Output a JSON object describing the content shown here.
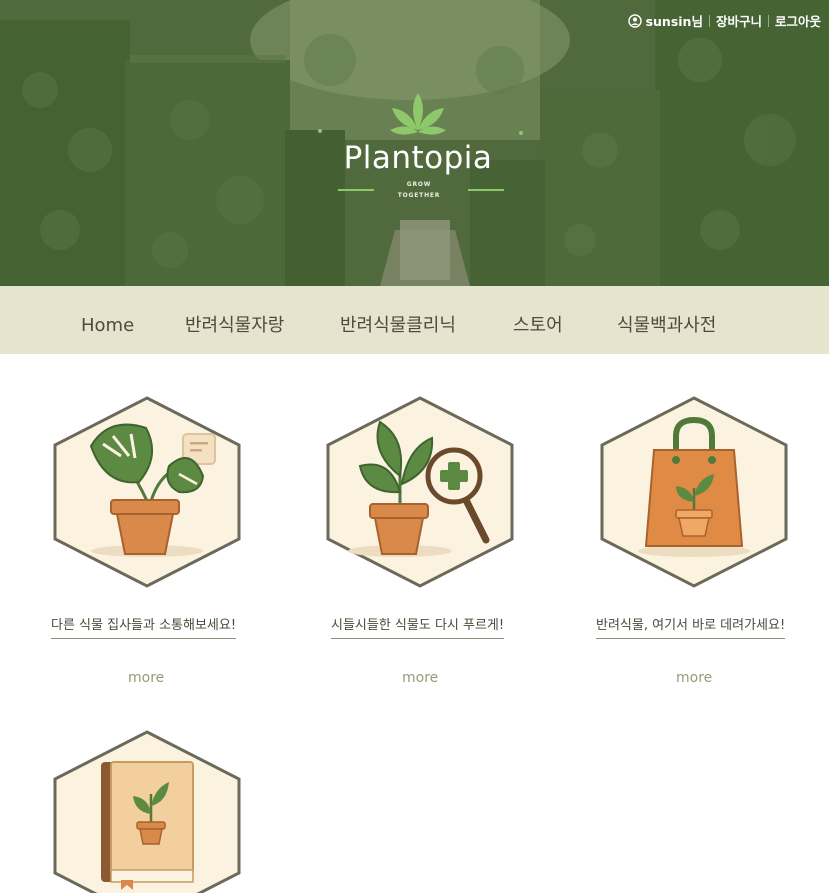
{
  "header": {
    "username": "sunsin님",
    "cart_label": "장바구니",
    "logout_label": "로그아웃",
    "logo_title": "Plantopia",
    "logo_tag_1": "GROW",
    "logo_tag_2": "TOGETHER"
  },
  "nav": {
    "items": [
      "Home",
      "반려식물자랑",
      "반려식물클리닉",
      "스토어",
      "식물백과사전"
    ]
  },
  "cards": [
    {
      "caption": "다른 식물 집사들과 소통해보세요!",
      "more": "more",
      "icon": "monstera-chat-icon"
    },
    {
      "caption": "시들시들한 식물도 다시 푸르게!",
      "more": "more",
      "icon": "plant-magnifier-icon"
    },
    {
      "caption": "반려식물, 여기서 바로 데려가세요!",
      "more": "more",
      "icon": "shopping-bag-plant-icon"
    },
    {
      "caption": "",
      "more": "",
      "icon": "plant-book-icon"
    }
  ],
  "colors": {
    "nav_background": "#e6e4cf",
    "hex_fill": "#fbf2e0",
    "hex_border": "#6b6a5a",
    "pot": "#d9894a",
    "leaf": "#4f7a3a",
    "more_text": "#9a9a7a"
  }
}
